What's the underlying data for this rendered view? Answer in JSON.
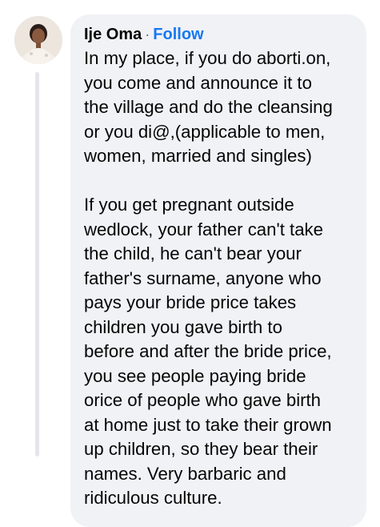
{
  "comment": {
    "author": "Ije Oma",
    "separator": "·",
    "follow_label": "Follow",
    "paragraph_1_lines": [
      "In my place, if you do aborti.on,",
      "you come and announce it to",
      "the village and do the cleansing",
      "or you di@,(applicable to men,",
      "women, married and singles)"
    ],
    "paragraph_2_lines": [
      "If you get pregnant outside",
      "wedlock, your father can't take",
      "the child, he can't bear your",
      "father's surname, anyone who",
      "pays your bride price takes",
      "children you gave birth to",
      "before and after the bride price,",
      "you see people paying bride",
      "orice of people who gave birth",
      "at home just to take their grown",
      "up children, so they bear their",
      "names. Very barbaric and",
      "ridiculous culture."
    ]
  },
  "colors": {
    "bubble_background": "#f0f2f5",
    "follow_link": "#1877f2",
    "text": "#050505",
    "thread_line": "#e4e6eb"
  },
  "icons": {
    "avatar": "profile-photo"
  }
}
